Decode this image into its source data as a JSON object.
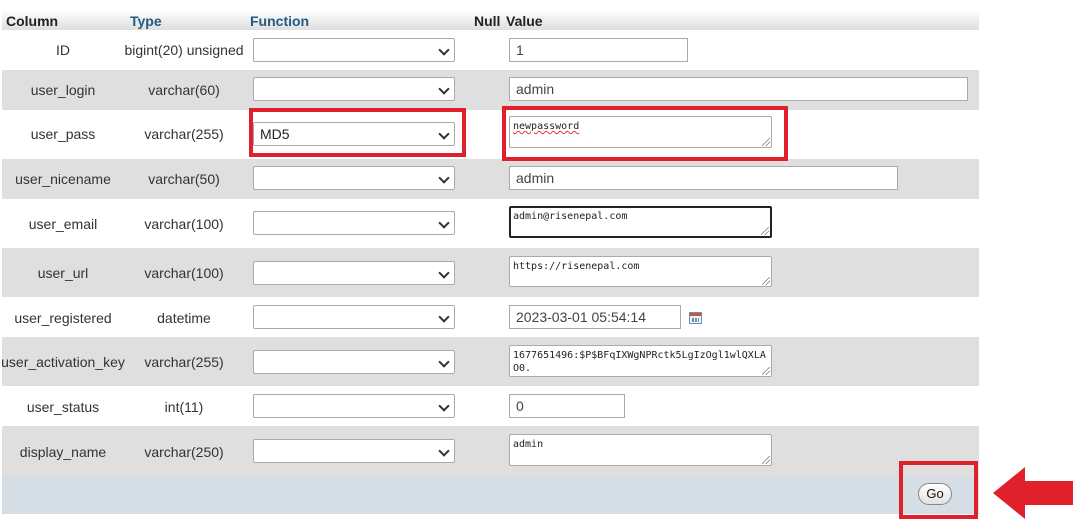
{
  "headers": {
    "column": "Column",
    "type": "Type",
    "function": "Function",
    "null": "Null",
    "value": "Value"
  },
  "rows": [
    {
      "column": "ID",
      "type": "bigint(20) unsigned",
      "function": "",
      "value": "1"
    },
    {
      "column": "user_login",
      "type": "varchar(60)",
      "function": "",
      "value": "admin"
    },
    {
      "column": "user_pass",
      "type": "varchar(255)",
      "function": "MD5",
      "value": "newpassword"
    },
    {
      "column": "user_nicename",
      "type": "varchar(50)",
      "function": "",
      "value": "admin"
    },
    {
      "column": "user_email",
      "type": "varchar(100)",
      "function": "",
      "value": "admin@risenepal.com"
    },
    {
      "column": "user_url",
      "type": "varchar(100)",
      "function": "",
      "value": "https://risenepal.com"
    },
    {
      "column": "user_registered",
      "type": "datetime",
      "function": "",
      "value": "2023-03-01 05:54:14"
    },
    {
      "column": "user_activation_key",
      "type": "varchar(255)",
      "function": "",
      "value": "1677651496:$P$BFqIXWgNPRctk5LgIzOgl1wlQXLAO0."
    },
    {
      "column": "user_status",
      "type": "int(11)",
      "function": "",
      "value": "0"
    },
    {
      "column": "display_name",
      "type": "varchar(250)",
      "function": "",
      "value": "admin"
    }
  ],
  "go_button": "Go",
  "icons": {
    "select_arrow": "chevron-down-icon",
    "calendar": "calendar-icon",
    "callout": "arrow-left-icon"
  },
  "colors": {
    "highlight": "#e0202a",
    "header_link": "#235a81",
    "row_alt": "#dfdfdf",
    "footer": "#d5dde5"
  }
}
